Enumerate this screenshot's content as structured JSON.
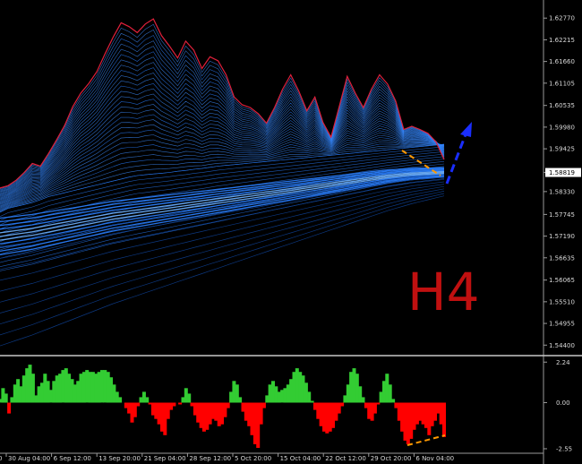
{
  "timeframe_label": "H4",
  "colors": {
    "background": "#000000",
    "axis": "#9a9a9a",
    "price_line": "#e0203a",
    "ribbon": "#2a7fff",
    "ribbon_dark": "#0d3d8c",
    "osc_positive": "#33cc33",
    "osc_negative": "#ff0000",
    "divergence": "#ff9900",
    "arrow": "#1a2eff",
    "timeframe_text": "#c01010"
  },
  "chart_data": [
    {
      "type": "line",
      "title": "",
      "price_axis": {
        "range": [
          1.542,
          1.6305
        ],
        "tick_labels": [
          "1.62770",
          "1.62215",
          "1.61660",
          "1.61105",
          "1.60535",
          "1.59980",
          "1.59425",
          "1.58819",
          "1.58330",
          "1.57745",
          "1.57190",
          "1.56635",
          "1.56065",
          "1.55510",
          "1.54955",
          "1.54400"
        ],
        "tick_values": [
          1.6277,
          1.62215,
          1.6166,
          1.61105,
          1.60535,
          1.5998,
          1.59425,
          1.58819,
          1.5833,
          1.57745,
          1.5719,
          1.56635,
          1.56065,
          1.5551,
          1.54955,
          1.544
        ],
        "current_price_label": "1.58819"
      },
      "date_labels": [
        "30 Aug 04:00",
        "6 Sep 12:00",
        "13 Sep 20:00",
        "21 Sep 04:00",
        "28 Sep 12:00",
        "5 Oct 20:00",
        "15 Oct 04:00",
        "22 Oct 12:00",
        "29 Oct 20:00",
        "6 Nov 04:00"
      ],
      "series": [
        {
          "values": [
            1.5842,
            1.5848,
            1.5862,
            1.5882,
            1.5905,
            1.5898,
            1.593,
            1.5965,
            1.6002,
            1.605,
            1.6085,
            1.611,
            1.614,
            1.6185,
            1.6228,
            1.6265,
            1.6255,
            1.624,
            1.6262,
            1.6275,
            1.6232,
            1.6205,
            1.6175,
            1.6218,
            1.6195,
            1.6148,
            1.6178,
            1.6168,
            1.6132,
            1.6075,
            1.6055,
            1.6048,
            1.6032,
            1.6008,
            1.6048,
            1.6095,
            1.6132,
            1.609,
            1.604,
            1.6075,
            1.601,
            1.5972,
            1.605,
            1.6128,
            1.6085,
            1.6048,
            1.6095,
            1.6132,
            1.6108,
            1.6065,
            1.5992,
            1.6,
            1.5992,
            1.5982,
            1.596,
            1.5915
          ]
        }
      ],
      "ribbon": {
        "fast_values": [
          1.584,
          1.5842,
          1.5855,
          1.5875,
          1.59,
          1.5925,
          1.596,
          1.6,
          1.6045,
          1.609,
          1.613,
          1.616,
          1.619,
          1.6215,
          1.6232,
          1.624,
          1.624,
          1.6232,
          1.6215,
          1.6195,
          1.617,
          1.6148,
          1.612,
          1.6095,
          1.607,
          1.605,
          1.604,
          1.6032,
          1.603,
          1.603,
          1.603,
          1.603,
          1.603,
          1.603,
          1.603,
          1.603,
          1.603,
          1.603,
          1.603,
          1.603,
          1.603,
          1.603,
          1.6035,
          1.604,
          1.6045,
          1.6045,
          1.604,
          1.6035,
          1.603,
          1.603,
          1.6032,
          1.603,
          1.6028,
          1.602,
          1.601,
          1.6
        ],
        "slow_values": [
          1.578,
          1.579,
          1.5795,
          1.58,
          1.5805,
          1.5812,
          1.582,
          1.5825,
          1.583,
          1.5835,
          1.584,
          1.5845,
          1.585,
          1.5855,
          1.586,
          1.5865,
          1.587,
          1.5874,
          1.5876,
          1.5878,
          1.588,
          1.5882,
          1.5885,
          1.5887,
          1.589,
          1.5892,
          1.5895,
          1.5898,
          1.59,
          1.5902,
          1.5904,
          1.5906,
          1.5908,
          1.591,
          1.5912,
          1.5914,
          1.5916,
          1.5918,
          1.592,
          1.5922,
          1.5924,
          1.5926,
          1.5928,
          1.593,
          1.5932,
          1.5934,
          1.5936,
          1.5938,
          1.594,
          1.5942,
          1.5944,
          1.5946,
          1.5948,
          1.595,
          1.5952,
          1.5954
        ],
        "bundle_center": [
          1.5718,
          1.5721,
          1.5724,
          1.5727,
          1.573,
          1.5734,
          1.5738,
          1.5742,
          1.5746,
          1.575,
          1.5754,
          1.5758,
          1.5762,
          1.5766,
          1.577,
          1.5773,
          1.5776,
          1.5779,
          1.5782,
          1.5785,
          1.5788,
          1.5791,
          1.5794,
          1.5797,
          1.58,
          1.5803,
          1.5806,
          1.5809,
          1.5812,
          1.5815,
          1.5818,
          1.5821,
          1.5824,
          1.5827,
          1.583,
          1.5833,
          1.5836,
          1.5839,
          1.5842,
          1.5845,
          1.5848,
          1.5851,
          1.5854,
          1.5857,
          1.586,
          1.5863,
          1.5866,
          1.5869,
          1.5872,
          1.5874,
          1.5876,
          1.5878,
          1.5879,
          1.588,
          1.5881,
          1.5882
        ]
      }
    },
    {
      "type": "area",
      "title": "",
      "axis": {
        "range": [
          -2.7,
          2.5
        ],
        "tick_labels": [
          "2.24",
          "0.00",
          "-2.55"
        ],
        "tick_values": [
          2.24,
          0.0,
          -2.55
        ]
      },
      "series": [
        {
          "values": [
            0.2,
            0.8,
            0.5,
            -0.6,
            0.3,
            1.0,
            1.3,
            0.9,
            1.5,
            1.9,
            2.1,
            1.6,
            0.4,
            0.9,
            1.1,
            1.6,
            1.2,
            0.7,
            1.2,
            1.5,
            1.6,
            1.8,
            1.9,
            1.6,
            1.3,
            1.0,
            1.2,
            1.6,
            1.7,
            1.8,
            1.7,
            1.7,
            1.6,
            1.7,
            1.8,
            1.8,
            1.7,
            1.4,
            1.0,
            0.6,
            0.3,
            0.0,
            -0.3,
            -0.6,
            -1.1,
            -0.8,
            -0.2,
            0.3,
            0.6,
            0.3,
            -0.1,
            -0.7,
            -0.9,
            -1.2,
            -1.6,
            -1.8,
            -0.9,
            -0.4,
            -0.2,
            0.0,
            -0.1,
            0.3,
            0.8,
            0.5,
            -0.2,
            -0.7,
            -1.1,
            -1.4,
            -1.6,
            -1.5,
            -1.2,
            -0.9,
            -1.0,
            -1.3,
            -1.2,
            -0.8,
            -0.3,
            0.6,
            1.2,
            1.0,
            0.3,
            -0.5,
            -1.0,
            -1.3,
            -1.8,
            -2.3,
            -2.5,
            -1.2,
            -0.3,
            0.4,
            1.0,
            1.2,
            0.9,
            0.6,
            0.7,
            0.8,
            1.0,
            1.3,
            1.7,
            1.9,
            1.7,
            1.5,
            1.1,
            0.6,
            0.1,
            -0.4,
            -0.9,
            -1.3,
            -1.6,
            -1.7,
            -1.6,
            -1.4,
            -1.0,
            -0.6,
            -0.2,
            0.4,
            1.0,
            1.7,
            1.9,
            1.6,
            0.9,
            0.3,
            -0.3,
            -0.9,
            -1.0,
            -0.6,
            -0.1,
            0.6,
            1.2,
            1.6,
            1.0,
            0.2,
            -0.3,
            -1.0,
            -1.6,
            -2.1,
            -2.3,
            -2.0,
            -1.5,
            -1.2,
            -1.0,
            -1.2,
            -1.4,
            -1.8,
            -1.3,
            -1.0,
            -0.6,
            -1.2,
            -1.9
          ]
        }
      ]
    }
  ]
}
